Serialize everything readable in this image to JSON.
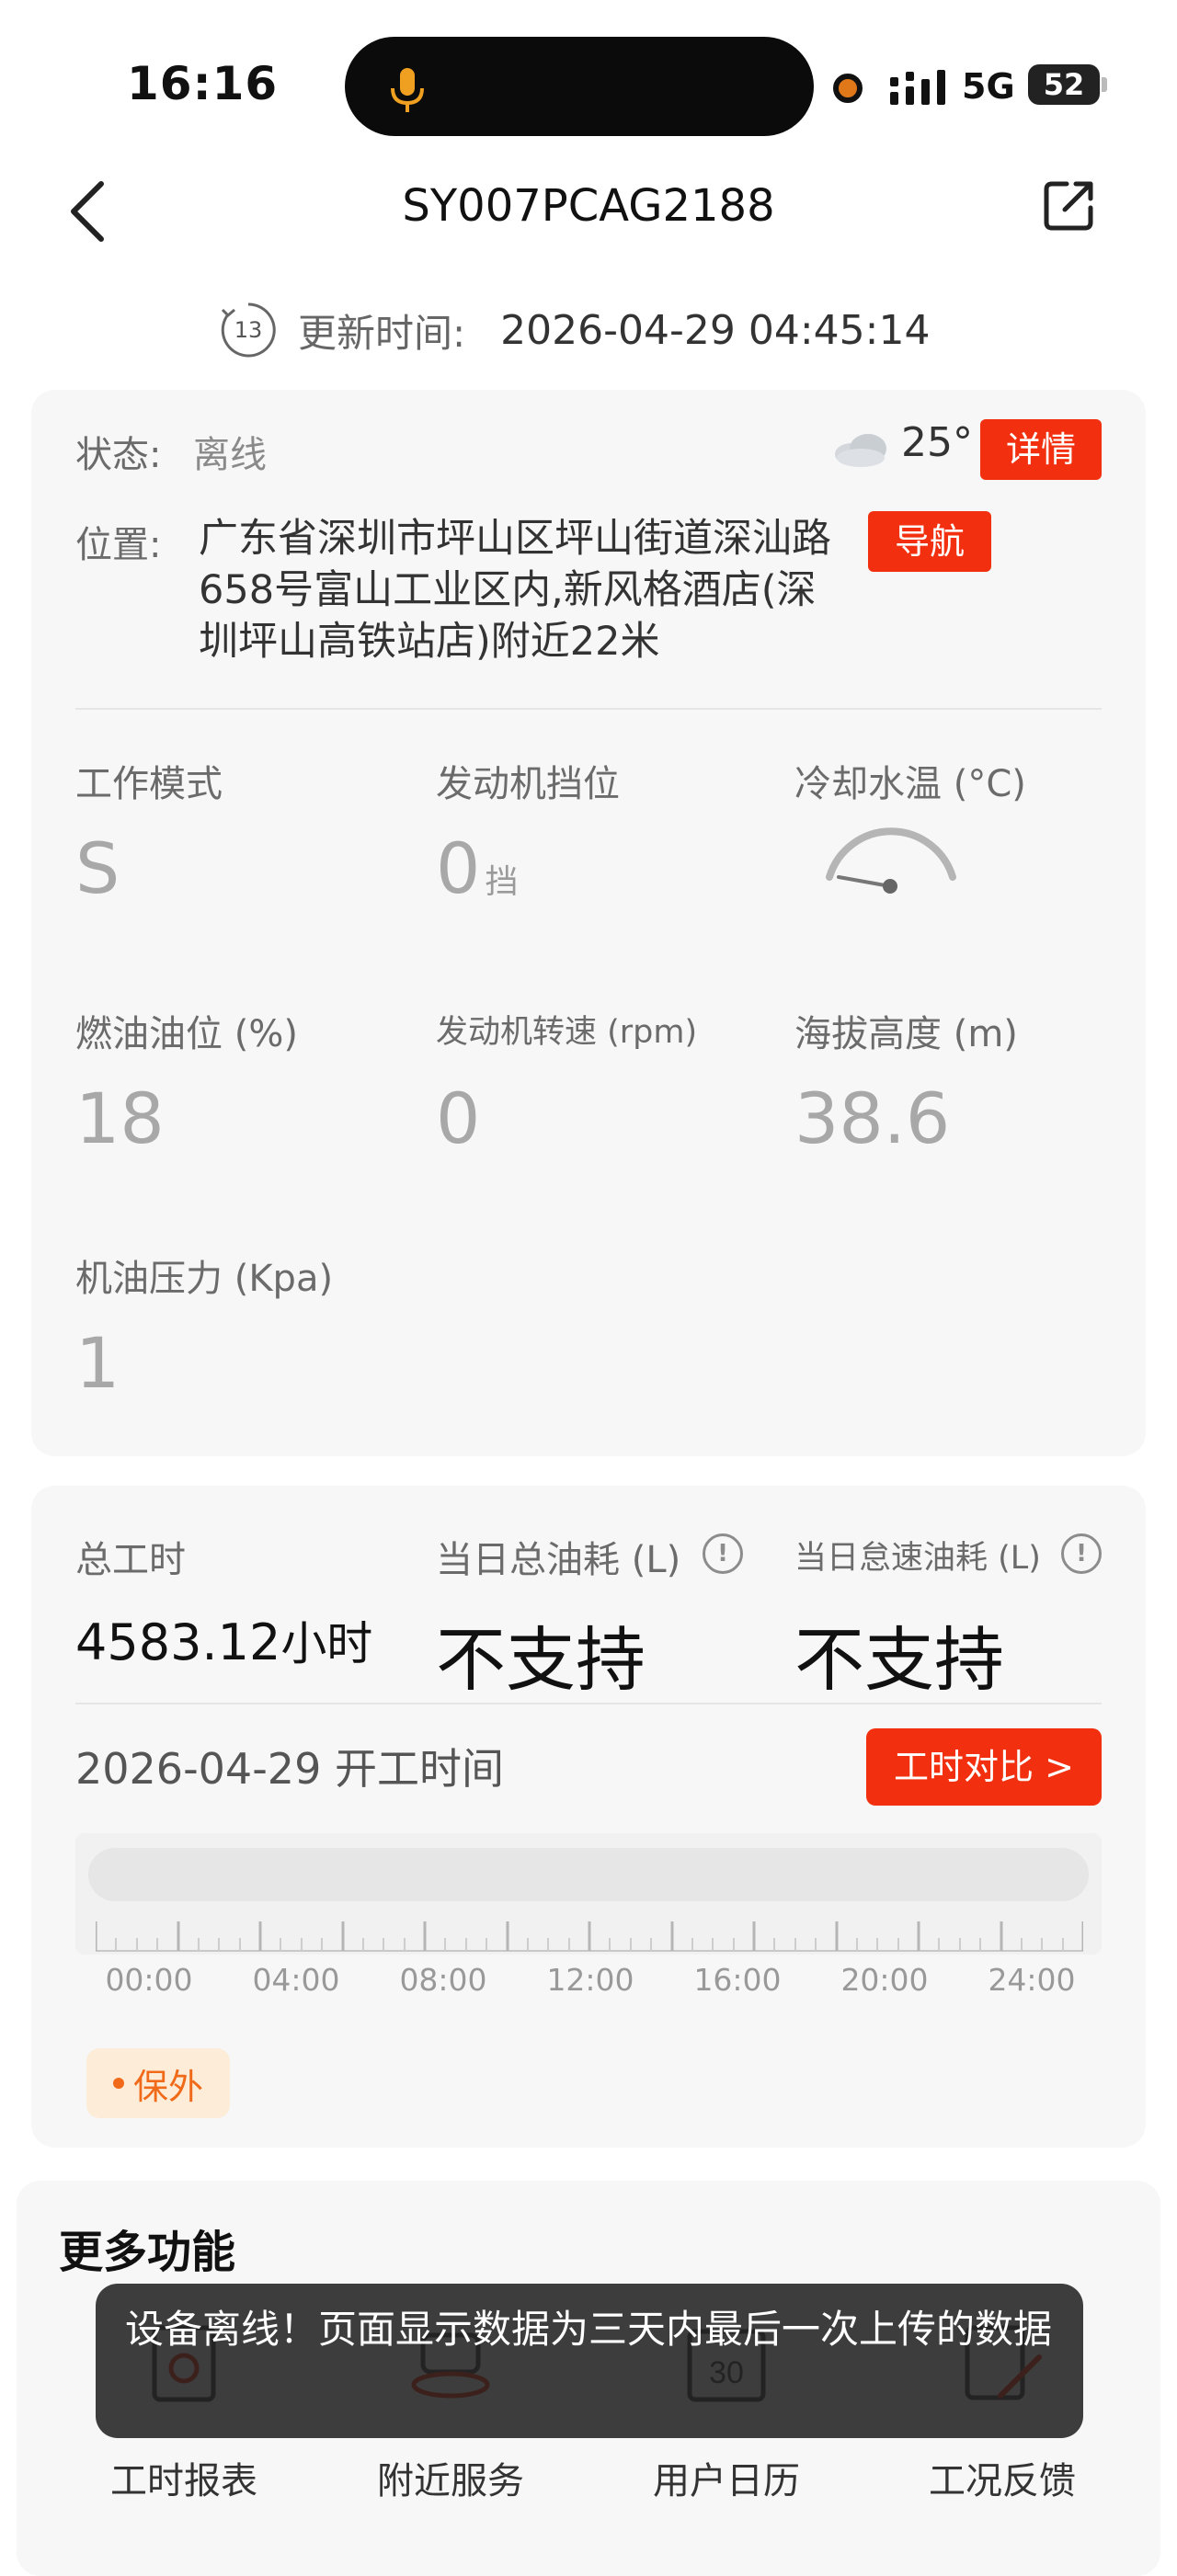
{
  "status_bar": {
    "time": "16:16",
    "network": "5G",
    "battery": "52"
  },
  "header": {
    "title": "SY007PCAG2188"
  },
  "update": {
    "countdown": "13",
    "label": "更新时间:",
    "time": "2026-04-29 04:45:14"
  },
  "status": {
    "label": "状态:",
    "value": "离线",
    "weather_icon": "cloud-icon",
    "temperature": "25°",
    "detail_button": "详情",
    "position_label": "位置:",
    "position_text": "广东省深圳市坪山区坪山街道深汕路658号富山工业区内,新风格酒店(深圳坪山高铁站店)附近22米",
    "nav_button": "导航"
  },
  "metrics": {
    "work_mode": {
      "label": "工作模式",
      "value": "S"
    },
    "gear": {
      "label": "发动机挡位",
      "value": "0",
      "unit": "挡"
    },
    "coolant": {
      "label": "冷却水温 (°C)",
      "gauge_level": 0.0
    },
    "fuel": {
      "label": "燃油油位 (%)",
      "value": "18"
    },
    "rpm": {
      "label": "发动机转速 (rpm)",
      "value": "0"
    },
    "altitude": {
      "label": "海拔高度 (m)",
      "value": "38.6"
    },
    "oil_pressure": {
      "label": "机油压力 (Kpa)",
      "value": "1"
    }
  },
  "work": {
    "total_hours_label": "总工时",
    "total_hours_value": "4583.12",
    "total_hours_unit": "小时",
    "daily_fuel_label": "当日总油耗 (L)",
    "daily_fuel_value": "不支持",
    "idle_fuel_label": "当日怠速油耗 (L)",
    "idle_fuel_value": "不支持",
    "info_glyph": "!",
    "start_title": "2026-04-29 开工时间",
    "compare_button": "工时对比 >",
    "timeline_labels": [
      "00:00",
      "04:00",
      "08:00",
      "12:00",
      "16:00",
      "20:00",
      "24:00"
    ],
    "warranty_badge": "保外"
  },
  "more": {
    "title": "更多功能",
    "items": [
      {
        "label": "工时报表",
        "icon": "report-icon"
      },
      {
        "label": "附近服务",
        "icon": "service-icon"
      },
      {
        "label": "用户日历",
        "icon": "calendar-icon",
        "icon_text": "30"
      },
      {
        "label": "工况反馈",
        "icon": "feedback-icon"
      }
    ]
  },
  "toast": {
    "message": "设备离线！页面显示数据为三天内最后一次上传的数据"
  },
  "colors": {
    "accent": "#f2300f",
    "badge": "#f06a1a"
  }
}
